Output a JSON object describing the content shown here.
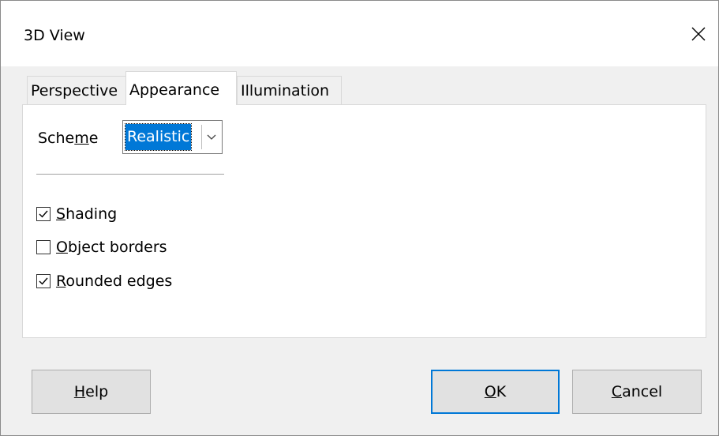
{
  "window": {
    "title": "3D View"
  },
  "tabs": [
    {
      "label": "Perspective"
    },
    {
      "label": "Appearance"
    },
    {
      "label": "Illumination"
    }
  ],
  "scheme": {
    "label_pre": "Sche",
    "label_mn": "m",
    "label_post": "e",
    "value": "Realistic"
  },
  "options": [
    {
      "mn": "S",
      "rest": "hading",
      "checked": true
    },
    {
      "mn": "O",
      "rest": "bject borders",
      "checked": false
    },
    {
      "mn": "R",
      "rest": "ounded edges",
      "checked": true
    }
  ],
  "buttons": {
    "help": {
      "mn": "H",
      "rest": "elp"
    },
    "ok": {
      "mn": "O",
      "rest": "K"
    },
    "cancel": {
      "mn": "C",
      "rest": "ancel"
    }
  },
  "colors": {
    "accent": "#0078d7"
  },
  "icons": [
    "close-icon",
    "chevron-down-icon",
    "checkmark-icon"
  ]
}
